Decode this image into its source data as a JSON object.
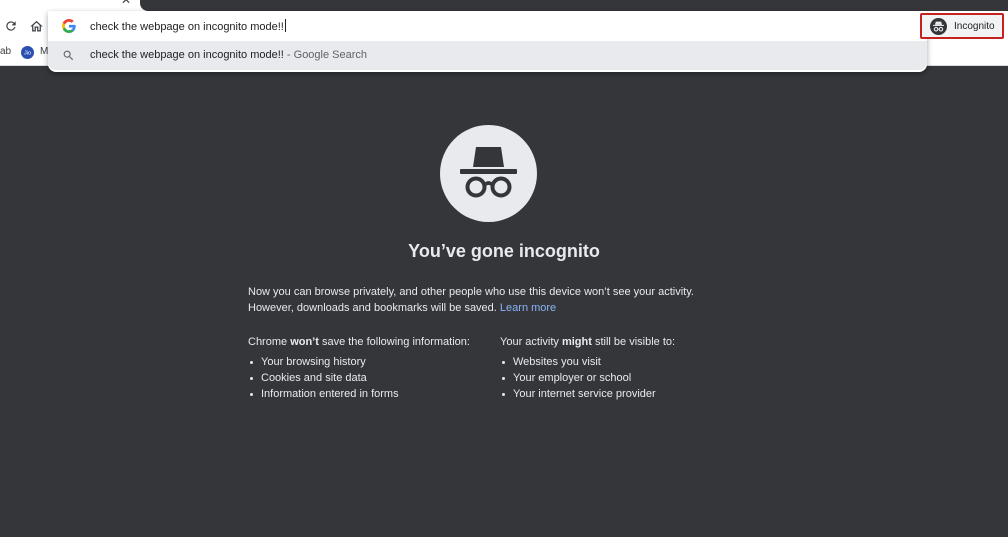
{
  "omnibox": {
    "input_value": "check the webpage on incognito mode!!",
    "suggestion_query": "check the webpage on incognito mode!!",
    "suggestion_suffix": " - Google Search"
  },
  "profile": {
    "label": "Incognito"
  },
  "bookmarks": [
    {
      "label": "ab"
    },
    {
      "label": "M"
    }
  ],
  "content": {
    "title": "You’ve gone incognito",
    "intro_line1": "Now you can browse privately, and other people who use this device won’t see your activity.",
    "intro_line2": "However, downloads and bookmarks will be saved.",
    "learn_more": "Learn more",
    "left_heading_pre": "Chrome ",
    "left_heading_bold": "won’t",
    "left_heading_post": " save the following information:",
    "left_items": [
      "Your browsing history",
      "Cookies and site data",
      "Information entered in forms"
    ],
    "right_heading_pre": "Your activity ",
    "right_heading_bold": "might",
    "right_heading_post": " still be visible to:",
    "right_items": [
      "Websites you visit",
      "Your employer or school",
      "Your internet service provider"
    ]
  },
  "colors": {
    "background": "#35363a",
    "text": "#e8eaed",
    "link": "#8ab4f8",
    "highlight_border": "#c5221f"
  }
}
